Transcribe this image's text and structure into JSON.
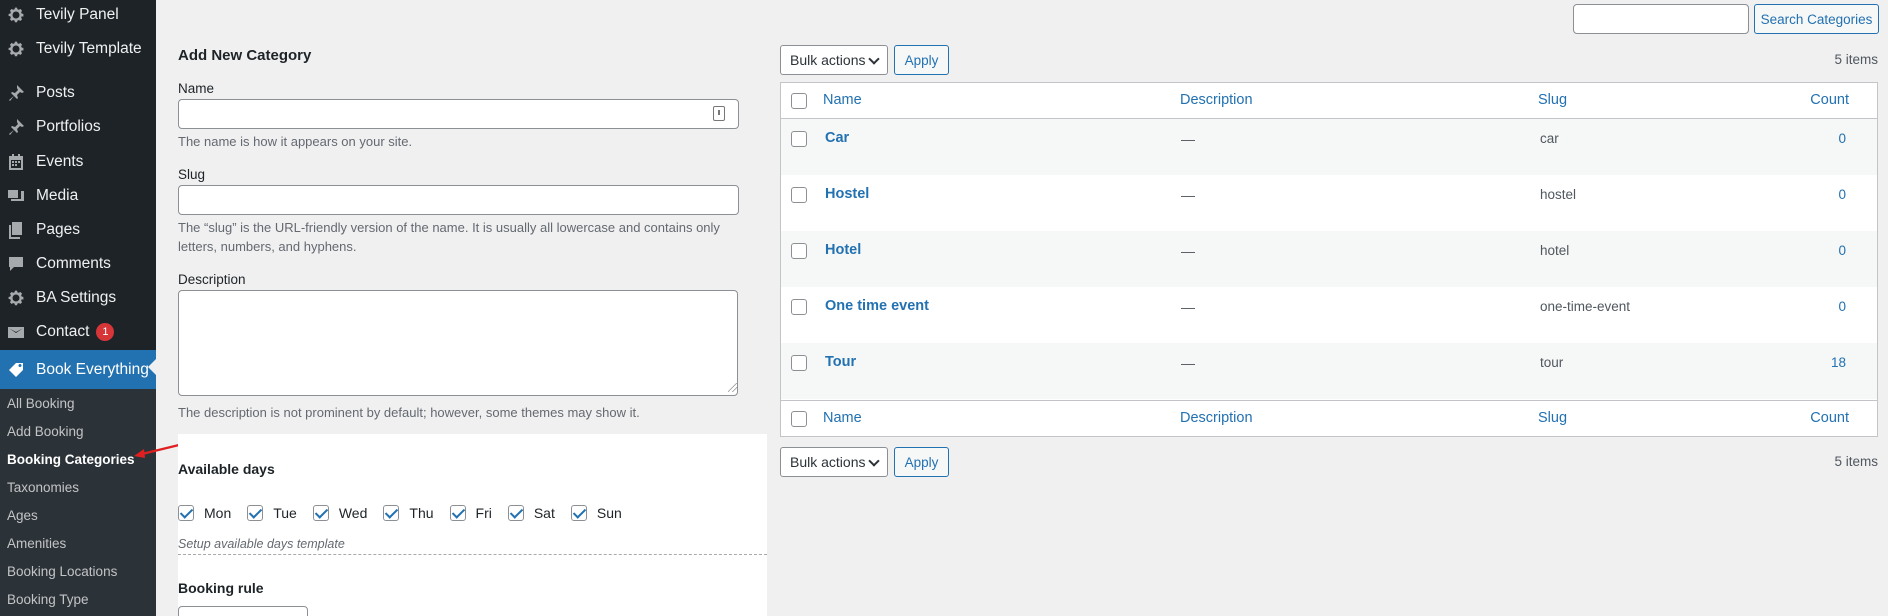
{
  "sidebar": {
    "items": [
      {
        "label": "Tevily Panel",
        "icon": "gear-icon"
      },
      {
        "label": "Tevily Template",
        "icon": "gear-icon"
      },
      {
        "label": "Posts",
        "icon": "pin-icon"
      },
      {
        "label": "Portfolios",
        "icon": "pin-icon"
      },
      {
        "label": "Events",
        "icon": "calendar-icon"
      },
      {
        "label": "Media",
        "icon": "media-icon"
      },
      {
        "label": "Pages",
        "icon": "pages-icon"
      },
      {
        "label": "Comments",
        "icon": "comment-icon"
      },
      {
        "label": "BA Settings",
        "icon": "gear-icon"
      },
      {
        "label": "Contact",
        "icon": "mail-icon",
        "badge": "1"
      },
      {
        "label": "Book Everything",
        "icon": "tag-icon"
      }
    ],
    "submenu": [
      "All Booking",
      "Add Booking",
      "Booking Categories",
      "Taxonomies",
      "Ages",
      "Amenities",
      "Booking Locations",
      "Booking Type"
    ],
    "current_submenu": "Booking Categories"
  },
  "form": {
    "title": "Add New Category",
    "name_label": "Name",
    "name_help": "The name is how it appears on your site.",
    "slug_label": "Slug",
    "slug_help": "The “slug” is the URL-friendly version of the name. It is usually all lowercase and contains only letters, numbers, and hyphens.",
    "description_label": "Description",
    "description_help": "The description is not prominent by default; however, some themes may show it.",
    "available_days_title": "Available days",
    "days": [
      "Mon",
      "Tue",
      "Wed",
      "Thu",
      "Fri",
      "Sat",
      "Sun"
    ],
    "days_note": "Setup available days template",
    "booking_rule_title": "Booking rule"
  },
  "toolbar": {
    "search_button": "Search Categories",
    "bulk_actions": "Bulk actions",
    "apply": "Apply",
    "items_count": "5 items"
  },
  "table": {
    "headers": {
      "name": "Name",
      "description": "Description",
      "slug": "Slug",
      "count": "Count"
    },
    "rows": [
      {
        "name": "Car",
        "description": "—",
        "slug": "car",
        "count": "0"
      },
      {
        "name": "Hostel",
        "description": "—",
        "slug": "hostel",
        "count": "0"
      },
      {
        "name": "Hotel",
        "description": "—",
        "slug": "hotel",
        "count": "0"
      },
      {
        "name": "One time event",
        "description": "—",
        "slug": "one-time-event",
        "count": "0"
      },
      {
        "name": "Tour",
        "description": "—",
        "slug": "tour",
        "count": "18"
      }
    ]
  },
  "colors": {
    "accent": "#2271b1",
    "sidebar_bg": "#1d2327",
    "badge": "#d63638",
    "annotation_arrow": "#e02020"
  }
}
